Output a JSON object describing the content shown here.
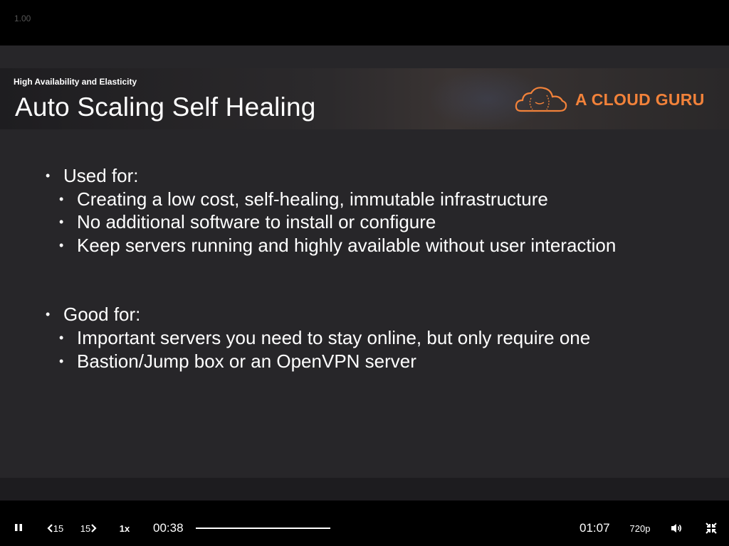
{
  "top": {
    "speed_indicator": "1.00"
  },
  "slide": {
    "section_label": "High Availability and Elasticity",
    "title": "Auto Scaling Self Healing",
    "logo_text": "A CLOUD GURU",
    "brand_color": "#f2823a",
    "groups": [
      {
        "heading": "Used for:",
        "items": [
          "Creating a low cost, self-healing, immutable infrastructure",
          "No additional software to install or configure",
          "Keep servers running and highly available without user interaction"
        ]
      },
      {
        "heading": "Good for:",
        "items": [
          "Important servers you need to stay online, but only require one",
          "Bastion/Jump box or an OpenVPN server"
        ]
      }
    ]
  },
  "player": {
    "icons": {
      "play_pause": "pause-icon",
      "skip_back": "rewind-15-icon",
      "skip_forward": "forward-15-icon",
      "volume": "volume-icon",
      "exit_fullscreen": "exit-fullscreen-icon"
    },
    "skip_back_label": "15",
    "skip_forward_label": "15",
    "playback_rate": "1x",
    "current_time": "00:38",
    "duration": "01:07",
    "quality": "720p"
  }
}
